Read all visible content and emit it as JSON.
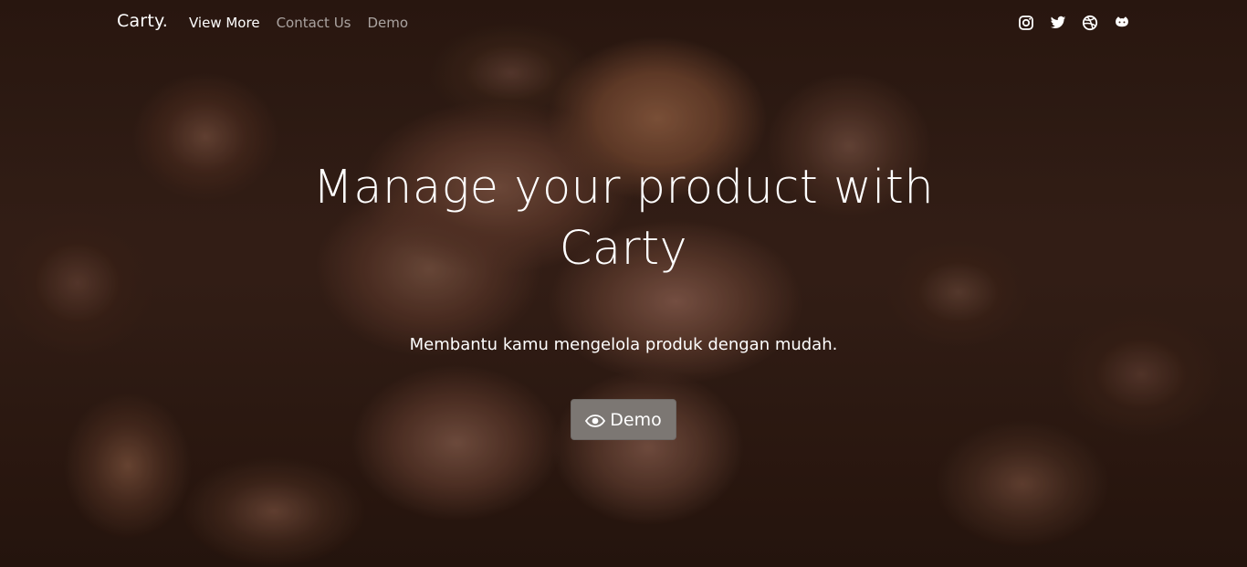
{
  "navbar": {
    "brand": "Carty.",
    "links": [
      {
        "label": "View More",
        "active": true
      },
      {
        "label": "Contact Us",
        "active": false
      },
      {
        "label": "Demo",
        "active": false
      }
    ],
    "social_icons": [
      "instagram-icon",
      "twitter-icon",
      "dribbble-icon",
      "github-icon"
    ]
  },
  "hero": {
    "title": "Manage your product with Carty",
    "subtitle": "Membantu kamu mengelola produk dengan mudah.",
    "button_label": "Demo",
    "button_icon": "eye-icon",
    "background": "coffee-beans-photo"
  },
  "colors": {
    "text": "#ffffff",
    "button_bg": "#7c7773"
  }
}
